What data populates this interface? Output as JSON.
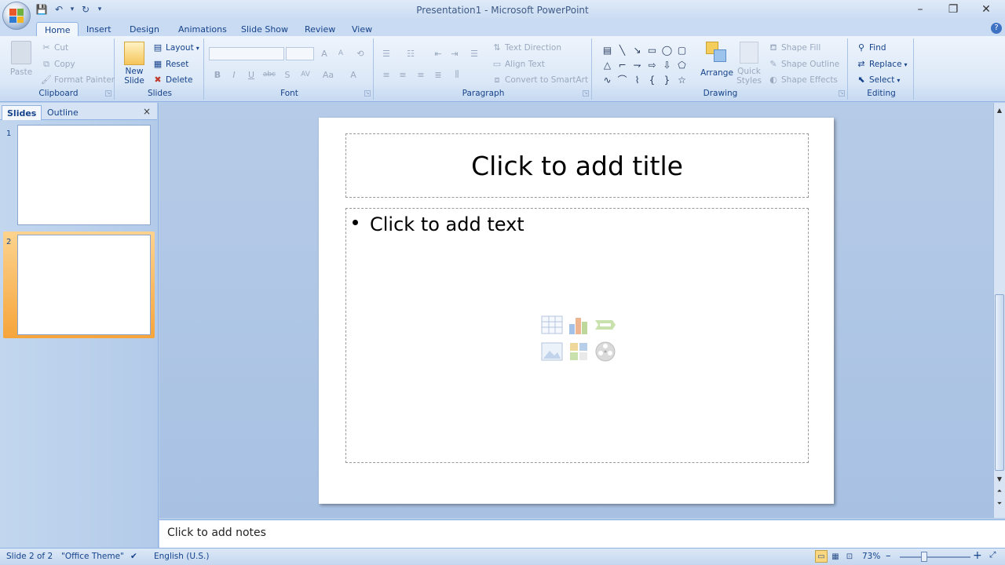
{
  "window": {
    "title": "Presentation1 - Microsoft PowerPoint",
    "minimize": "–",
    "restore": "❐",
    "close": "✕"
  },
  "qat": {
    "save": "💾",
    "undo": "↶",
    "undo_drop": "▾",
    "redo": "↻",
    "customize": "▾"
  },
  "tabs": [
    "Home",
    "Insert",
    "Design",
    "Animations",
    "Slide Show",
    "Review",
    "View"
  ],
  "help": "?",
  "ribbon": {
    "clipboard": {
      "label": "Clipboard",
      "paste": "Paste",
      "cut": "Cut",
      "copy": "Copy",
      "format_painter": "Format Painter"
    },
    "slides": {
      "label": "Slides",
      "new_slide_1": "New",
      "new_slide_2": "Slide",
      "layout": "Layout",
      "reset": "Reset",
      "delete": "Delete"
    },
    "font": {
      "label": "Font",
      "bold": "B",
      "italic": "I",
      "underline": "U",
      "strike": "abc",
      "shadow": "S",
      "spacing": "AV",
      "case": "Aa",
      "color": "A",
      "grow": "A",
      "shrink": "A"
    },
    "paragraph": {
      "label": "Paragraph",
      "text_direction": "Text Direction",
      "align_text": "Align Text",
      "convert_smartart": "Convert to SmartArt"
    },
    "drawing": {
      "label": "Drawing",
      "arrange": "Arrange",
      "quick_styles_1": "Quick",
      "quick_styles_2": "Styles",
      "shape_fill": "Shape Fill",
      "shape_outline": "Shape Outline",
      "shape_effects": "Shape Effects"
    },
    "editing": {
      "label": "Editing",
      "find": "Find",
      "replace": "Replace",
      "select": "Select"
    }
  },
  "left_pane": {
    "tab_slides": "Slides",
    "tab_outline": "Outline",
    "close": "×",
    "thumbnails": [
      {
        "number": "1"
      },
      {
        "number": "2"
      }
    ]
  },
  "slide": {
    "title_placeholder": "Click to add title",
    "body_placeholder": "Click to add text"
  },
  "notes": {
    "placeholder": "Click to add notes"
  },
  "status": {
    "slide_info": "Slide 2 of 2",
    "theme": "\"Office Theme\"",
    "language": "English (U.S.)",
    "zoom": "73%",
    "zoom_out": "–",
    "zoom_in": "+"
  },
  "colors": {
    "accent": "#15428b",
    "ribbon_bg": "#dbe8f7",
    "selected_thumb": "#f6a53b"
  }
}
